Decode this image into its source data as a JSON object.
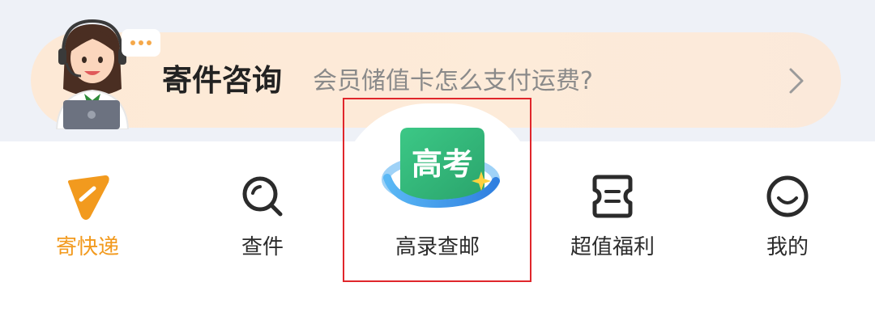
{
  "consult": {
    "title": "寄件咨询",
    "question": "会员储值卡怎么支付运费?",
    "agent_icon": "customer-service-agent",
    "arrow_icon": "chevron-right-icon"
  },
  "nav": {
    "items": [
      {
        "label": "寄快递",
        "icon": "send-parcel-icon",
        "active": true
      },
      {
        "label": "查件",
        "icon": "search-icon",
        "active": false
      },
      {
        "label": "高录查邮",
        "icon": "gaokao-badge-icon",
        "badge_text": "高考",
        "active": false
      },
      {
        "label": "超值福利",
        "icon": "coupon-icon",
        "active": false
      },
      {
        "label": "我的",
        "icon": "smiley-icon",
        "active": false
      }
    ]
  },
  "colors": {
    "accent": "#f29a1e",
    "highlight": "#e0262b",
    "pill_bg": "#fde9d6",
    "band_bg": "#eef1f7",
    "badge_green": "#2fb57a",
    "badge_blue": "#2f8fe0"
  }
}
